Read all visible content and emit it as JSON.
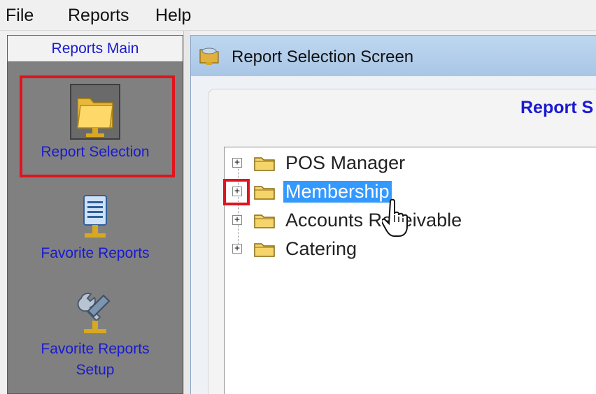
{
  "menu": {
    "items": [
      "File",
      "Reports",
      "Help"
    ]
  },
  "nav": {
    "header": "Reports Main",
    "items": [
      {
        "label": "Report Selection",
        "icon": "folder-icon",
        "selected": true
      },
      {
        "label": "Favorite Reports",
        "icon": "document-icon"
      },
      {
        "label_lines": [
          "Favorite Reports",
          "Setup"
        ],
        "icon": "wrench-icon"
      }
    ]
  },
  "window": {
    "title": "Report Selection Screen",
    "heading": "Report S"
  },
  "tree": {
    "items": [
      {
        "label": "POS Manager",
        "expander": "+",
        "selected": false
      },
      {
        "label": "Membership",
        "expander": "+",
        "selected": true
      },
      {
        "label": "Accounts Receivable",
        "expander": "+",
        "selected": false
      },
      {
        "label": "Catering",
        "expander": "+",
        "selected": false
      }
    ]
  },
  "colors": {
    "nav_text": "#1a1ad0",
    "highlight": "#e0141e",
    "selection": "#3399ff",
    "titlebar": "#b6d0ec"
  }
}
